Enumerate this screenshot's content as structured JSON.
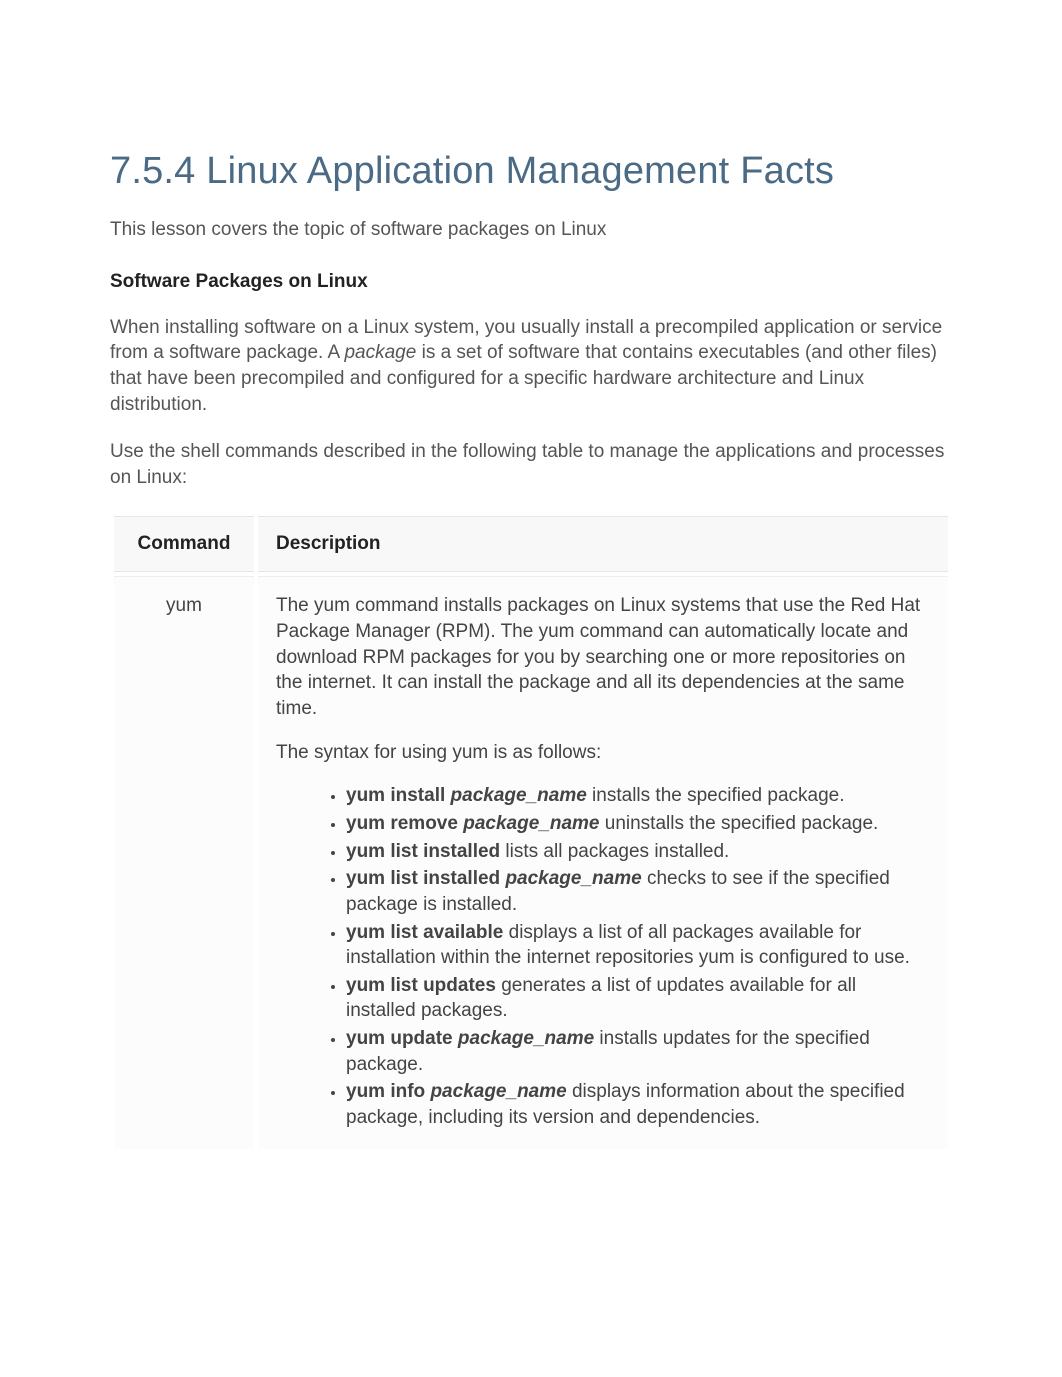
{
  "title": "7.5.4 Linux Application Management Facts",
  "intro": "This lesson covers the topic of software packages on Linux",
  "section_heading": "Software Packages on Linux",
  "para1_pre": "When installing software on a Linux system, you usually install a precompiled application or service from a software package. A ",
  "para1_ital": "package",
  "para1_post": " is a set of software that contains executables (and other files) that have been precompiled and configured for a specific hardware architecture and Linux distribution.",
  "para2": "Use the shell commands described in the following table to manage the applications and processes on Linux:",
  "table": {
    "header_cmd": "Command",
    "header_desc": "Description",
    "rows": [
      {
        "command": "yum",
        "desc1": "The yum command installs packages on Linux systems that use the Red Hat Package Manager (RPM). The yum command can automatically locate and download RPM packages for you by searching one or more repositories on the internet. It can install the package and all its dependencies at the same time.",
        "desc2": "The syntax for using yum is as follows:",
        "bullets": [
          {
            "cmd": "yum install ",
            "arg": "package_name",
            "rest": " installs the specified package."
          },
          {
            "cmd": "yum remove ",
            "arg": "package_name",
            "rest": " uninstalls the specified package."
          },
          {
            "cmd": "yum list installed",
            "arg": "",
            "rest": " lists all packages installed."
          },
          {
            "cmd": "yum list installed ",
            "arg": "package_name",
            "rest": " checks to see if the specified package is installed."
          },
          {
            "cmd": "yum list available",
            "arg": "",
            "rest": " displays a list of all packages available for installation within the internet repositories yum is configured to use."
          },
          {
            "cmd": "yum list updates",
            "arg": "",
            "rest": " generates a list of updates available for all installed packages."
          },
          {
            "cmd": "yum update ",
            "arg": "package_name",
            "rest": " installs updates for the specified package."
          },
          {
            "cmd": "yum info ",
            "arg": "package_name",
            "rest": " displays information about the specified package, including its version and dependencies."
          }
        ]
      }
    ]
  }
}
